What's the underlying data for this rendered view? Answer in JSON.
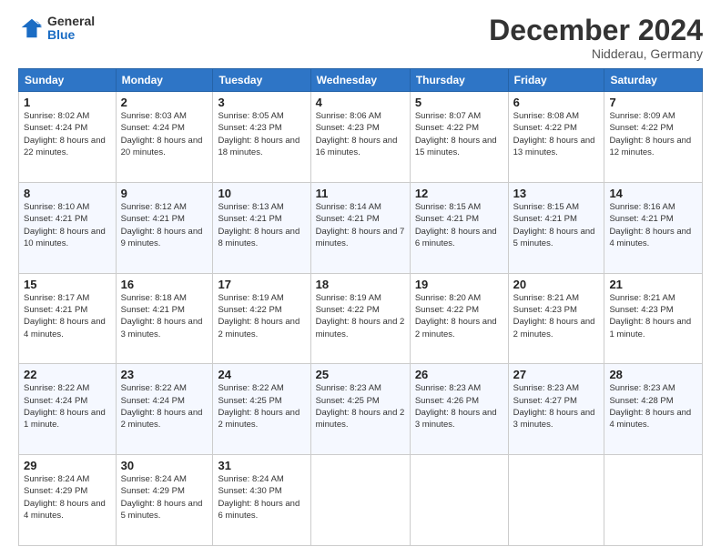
{
  "logo": {
    "general": "General",
    "blue": "Blue"
  },
  "header": {
    "month": "December 2024",
    "location": "Nidderau, Germany"
  },
  "days_of_week": [
    "Sunday",
    "Monday",
    "Tuesday",
    "Wednesday",
    "Thursday",
    "Friday",
    "Saturday"
  ],
  "weeks": [
    [
      {
        "day": 1,
        "info": "Sunrise: 8:02 AM\nSunset: 4:24 PM\nDaylight: 8 hours and 22 minutes."
      },
      {
        "day": 2,
        "info": "Sunrise: 8:03 AM\nSunset: 4:24 PM\nDaylight: 8 hours and 20 minutes."
      },
      {
        "day": 3,
        "info": "Sunrise: 8:05 AM\nSunset: 4:23 PM\nDaylight: 8 hours and 18 minutes."
      },
      {
        "day": 4,
        "info": "Sunrise: 8:06 AM\nSunset: 4:23 PM\nDaylight: 8 hours and 16 minutes."
      },
      {
        "day": 5,
        "info": "Sunrise: 8:07 AM\nSunset: 4:22 PM\nDaylight: 8 hours and 15 minutes."
      },
      {
        "day": 6,
        "info": "Sunrise: 8:08 AM\nSunset: 4:22 PM\nDaylight: 8 hours and 13 minutes."
      },
      {
        "day": 7,
        "info": "Sunrise: 8:09 AM\nSunset: 4:22 PM\nDaylight: 8 hours and 12 minutes."
      }
    ],
    [
      {
        "day": 8,
        "info": "Sunrise: 8:10 AM\nSunset: 4:21 PM\nDaylight: 8 hours and 10 minutes."
      },
      {
        "day": 9,
        "info": "Sunrise: 8:12 AM\nSunset: 4:21 PM\nDaylight: 8 hours and 9 minutes."
      },
      {
        "day": 10,
        "info": "Sunrise: 8:13 AM\nSunset: 4:21 PM\nDaylight: 8 hours and 8 minutes."
      },
      {
        "day": 11,
        "info": "Sunrise: 8:14 AM\nSunset: 4:21 PM\nDaylight: 8 hours and 7 minutes."
      },
      {
        "day": 12,
        "info": "Sunrise: 8:15 AM\nSunset: 4:21 PM\nDaylight: 8 hours and 6 minutes."
      },
      {
        "day": 13,
        "info": "Sunrise: 8:15 AM\nSunset: 4:21 PM\nDaylight: 8 hours and 5 minutes."
      },
      {
        "day": 14,
        "info": "Sunrise: 8:16 AM\nSunset: 4:21 PM\nDaylight: 8 hours and 4 minutes."
      }
    ],
    [
      {
        "day": 15,
        "info": "Sunrise: 8:17 AM\nSunset: 4:21 PM\nDaylight: 8 hours and 4 minutes."
      },
      {
        "day": 16,
        "info": "Sunrise: 8:18 AM\nSunset: 4:21 PM\nDaylight: 8 hours and 3 minutes."
      },
      {
        "day": 17,
        "info": "Sunrise: 8:19 AM\nSunset: 4:22 PM\nDaylight: 8 hours and 2 minutes."
      },
      {
        "day": 18,
        "info": "Sunrise: 8:19 AM\nSunset: 4:22 PM\nDaylight: 8 hours and 2 minutes."
      },
      {
        "day": 19,
        "info": "Sunrise: 8:20 AM\nSunset: 4:22 PM\nDaylight: 8 hours and 2 minutes."
      },
      {
        "day": 20,
        "info": "Sunrise: 8:21 AM\nSunset: 4:23 PM\nDaylight: 8 hours and 2 minutes."
      },
      {
        "day": 21,
        "info": "Sunrise: 8:21 AM\nSunset: 4:23 PM\nDaylight: 8 hours and 1 minute."
      }
    ],
    [
      {
        "day": 22,
        "info": "Sunrise: 8:22 AM\nSunset: 4:24 PM\nDaylight: 8 hours and 1 minute."
      },
      {
        "day": 23,
        "info": "Sunrise: 8:22 AM\nSunset: 4:24 PM\nDaylight: 8 hours and 2 minutes."
      },
      {
        "day": 24,
        "info": "Sunrise: 8:22 AM\nSunset: 4:25 PM\nDaylight: 8 hours and 2 minutes."
      },
      {
        "day": 25,
        "info": "Sunrise: 8:23 AM\nSunset: 4:25 PM\nDaylight: 8 hours and 2 minutes."
      },
      {
        "day": 26,
        "info": "Sunrise: 8:23 AM\nSunset: 4:26 PM\nDaylight: 8 hours and 3 minutes."
      },
      {
        "day": 27,
        "info": "Sunrise: 8:23 AM\nSunset: 4:27 PM\nDaylight: 8 hours and 3 minutes."
      },
      {
        "day": 28,
        "info": "Sunrise: 8:23 AM\nSunset: 4:28 PM\nDaylight: 8 hours and 4 minutes."
      }
    ],
    [
      {
        "day": 29,
        "info": "Sunrise: 8:24 AM\nSunset: 4:29 PM\nDaylight: 8 hours and 4 minutes."
      },
      {
        "day": 30,
        "info": "Sunrise: 8:24 AM\nSunset: 4:29 PM\nDaylight: 8 hours and 5 minutes."
      },
      {
        "day": 31,
        "info": "Sunrise: 8:24 AM\nSunset: 4:30 PM\nDaylight: 8 hours and 6 minutes."
      },
      null,
      null,
      null,
      null
    ]
  ]
}
